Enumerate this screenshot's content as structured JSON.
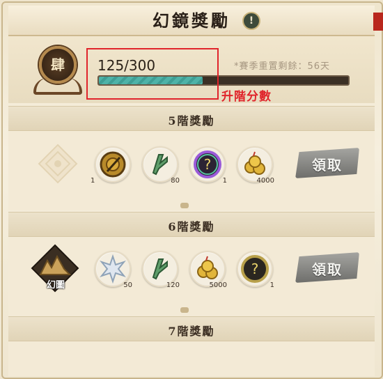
{
  "header": {
    "title": "幻鏡獎勵",
    "info_icon": "!",
    "rank_glyph": "肆",
    "score": "125/300",
    "progress": 0.4167,
    "season": "*賽季重置剩餘：56天",
    "annotation": "升階分數"
  },
  "tiers": [
    {
      "title": "5階獎勵",
      "claim_label": "領取",
      "items": [
        {
          "icon": "golden-compass-icon",
          "count": "1"
        },
        {
          "icon": "jade-clip-icon",
          "count": "80"
        },
        {
          "icon": "mystery-orb-rainbow-icon",
          "count": "1"
        },
        {
          "icon": "gold-coins-icon",
          "count": "4000"
        }
      ]
    },
    {
      "title": "6階獎勵",
      "claim_label": "領取",
      "emblem_label": "幻圖",
      "items": [
        {
          "icon": "crystal-star-icon",
          "count": "50"
        },
        {
          "icon": "jade-clip-icon",
          "count": "120"
        },
        {
          "icon": "gold-coins-icon",
          "count": "5000"
        },
        {
          "icon": "mystery-orb-gold-icon",
          "count": "1"
        }
      ]
    },
    {
      "title": "7階獎勵"
    }
  ],
  "colors": {
    "progress_fill": "#4fb3a8",
    "annotation_red": "#e0242b",
    "claim_button": "#8a8a86"
  }
}
